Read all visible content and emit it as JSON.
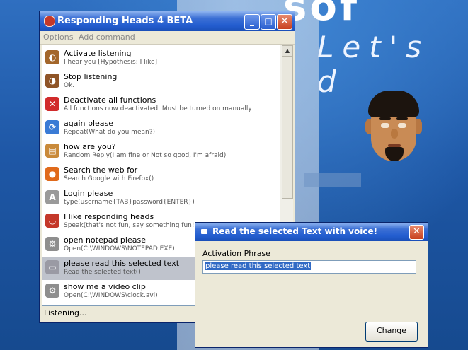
{
  "background": {
    "banner_text": "sof",
    "tagline": "Let's d"
  },
  "main_window": {
    "title": "Responding Heads 4 BETA",
    "menu": [
      "Options",
      "Add command"
    ],
    "commands": [
      {
        "name": "Activate listening",
        "sub": "I hear you [Hypothesis: I like]",
        "icon": "ear-icon",
        "icon_glyph": "◐",
        "color": "#a3662a"
      },
      {
        "name": "Stop listening",
        "sub": "Ok.",
        "icon": "ear-icon",
        "icon_glyph": "◑",
        "color": "#8f5426"
      },
      {
        "name": "Deactivate all functions",
        "sub": "All functions now deactivated. Must be turned on manually",
        "icon": "stop-icon",
        "icon_glyph": "✕",
        "color": "#d12b2b"
      },
      {
        "name": "again please",
        "sub": "Repeat(What do you mean?)",
        "icon": "refresh-icon",
        "icon_glyph": "⟳",
        "color": "#3a7bd5"
      },
      {
        "name": "how are you?",
        "sub": "Random Reply(I am fine or Not so good, I'm afraid)",
        "icon": "box-icon",
        "icon_glyph": "▤",
        "color": "#c98a3a"
      },
      {
        "name": "Search the web for",
        "sub": "Search Google with Firefox()",
        "icon": "firefox-icon",
        "icon_glyph": "●",
        "color": "#e06a1b"
      },
      {
        "name": "Login please",
        "sub": "type(username{TAB}password{ENTER})",
        "icon": "keyboard-icon",
        "icon_glyph": "A",
        "color": "#9a9a9a"
      },
      {
        "name": "I like responding heads",
        "sub": "Speak(that's not fun, say something fun!)",
        "icon": "lips-icon",
        "icon_glyph": "◡",
        "color": "#c4382a"
      },
      {
        "name": "open notepad please",
        "sub": "Open(C:\\WINDOWS\\NOTEPAD.EXE)",
        "icon": "gear-icon",
        "icon_glyph": "⚙",
        "color": "#8e8e8e"
      },
      {
        "name": "please read this selected text",
        "sub": "Read the selected text()",
        "icon": "speech-icon",
        "icon_glyph": "▭",
        "color": "#9a9aa4"
      },
      {
        "name": "show me a video clip",
        "sub": "Open(C:\\WINDOWS\\clock.avi)",
        "icon": "gear-icon",
        "icon_glyph": "⚙",
        "color": "#8e8e8e"
      }
    ],
    "selected_index": 9,
    "status": "Listening..."
  },
  "dialog": {
    "title": "Read the selected Text with voice!",
    "field_label": "Activation Phrase",
    "field_value": "please read this selected text",
    "button": "Change"
  }
}
